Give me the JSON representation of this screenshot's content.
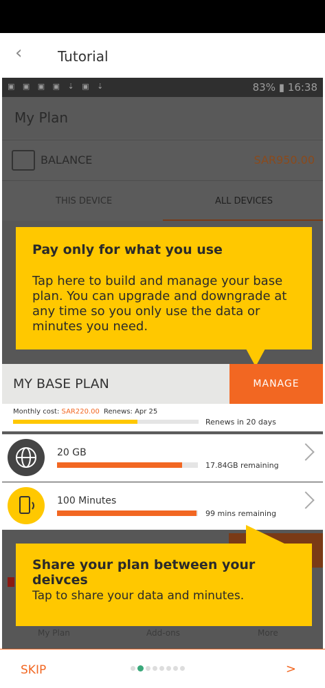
{
  "header": {
    "back_icon": "chevron-left-icon",
    "title": "Tutorial"
  },
  "screenshot": {
    "status_bar": {
      "right_text": "83% ▮ 16:38"
    },
    "page_title": "My Plan",
    "balance": {
      "label": "BALANCE",
      "amount": "SAR950.00"
    },
    "tabs": [
      "THIS DEVICE",
      "ALL DEVICES"
    ],
    "callout1": {
      "title": "Pay only for what you use",
      "body": "Tap here to build and manage your base plan. You can upgrade and downgrade at any time so you only use the data or minutes you need."
    },
    "base_plan": {
      "label": "MY BASE PLAN",
      "manage": "MANAGE",
      "monthly_cost_label": "Monthly cost:",
      "monthly_cost_value": "SAR220.00",
      "renews": "Renews: Apr 25",
      "renews_in": "Renews in 20 days",
      "progress": 0.67
    },
    "items": [
      {
        "name": "20 GB",
        "remaining": "17.84GB remaining",
        "fill": 0.89,
        "icon": "globe-icon"
      },
      {
        "name": "100 Minutes",
        "remaining": "99 mins remaining",
        "fill": 0.99,
        "icon": "phone-icon"
      }
    ],
    "callout2": {
      "title": "Share your plan between your deivces",
      "body": "Tap  to share your data and minutes."
    },
    "ghost_tabs": [
      "My Plan",
      "Add-ons",
      "More"
    ]
  },
  "footer": {
    "skip": "SKIP",
    "next": ">",
    "dots_total": 8,
    "active_dot": 1
  },
  "colors": {
    "accent": "#f26722",
    "yellow": "#ffc800",
    "dot_active": "#3aa87a"
  }
}
